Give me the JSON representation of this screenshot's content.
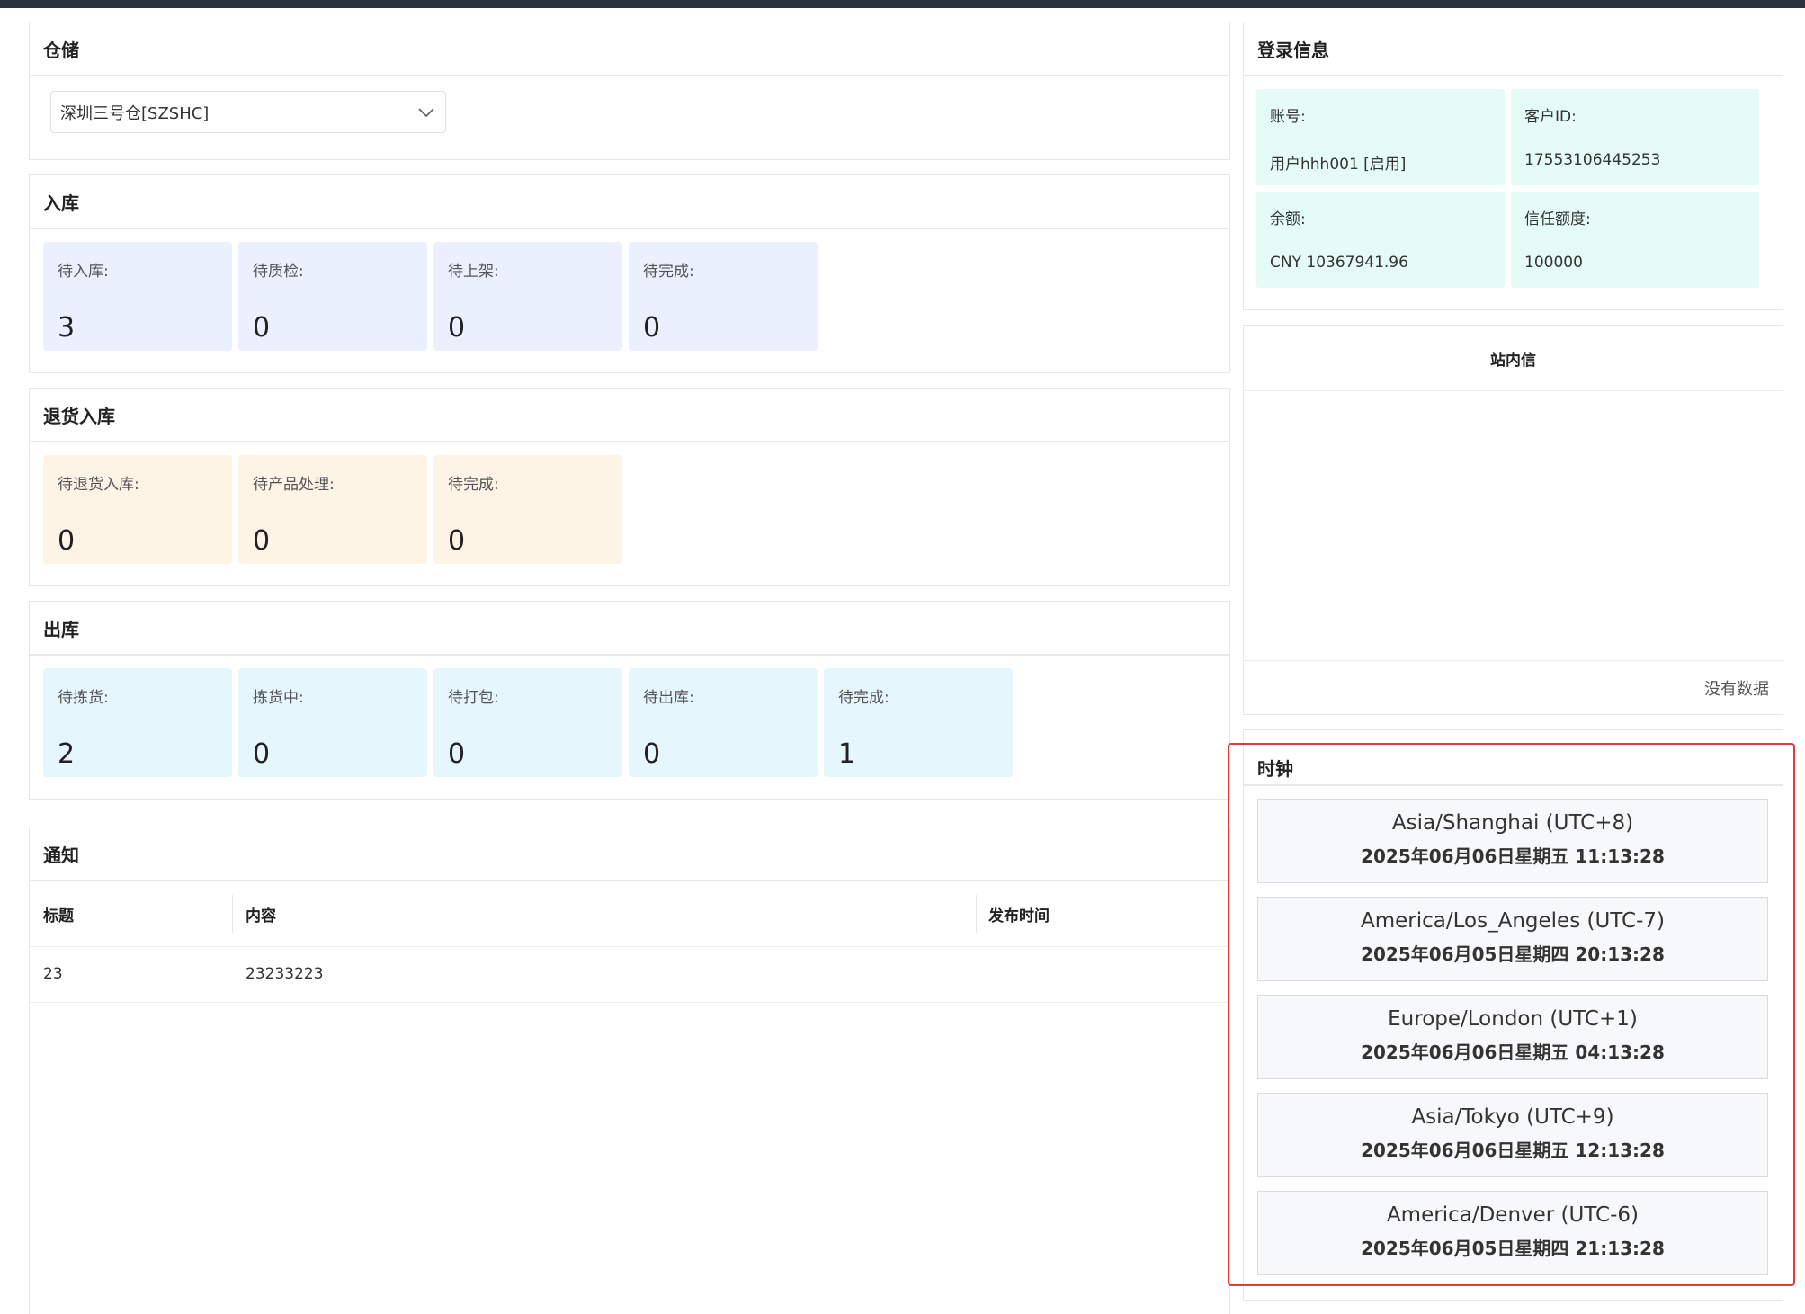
{
  "warehouse": {
    "title": "仓储",
    "selected": "深圳三号仓[SZSHC]"
  },
  "inbound": {
    "title": "入库",
    "cards": [
      {
        "label": "待入库:",
        "value": "3"
      },
      {
        "label": "待质检:",
        "value": "0"
      },
      {
        "label": "待上架:",
        "value": "0"
      },
      {
        "label": "待完成:",
        "value": "0"
      }
    ]
  },
  "returns": {
    "title": "退货入库",
    "cards": [
      {
        "label": "待退货入库:",
        "value": "0"
      },
      {
        "label": "待产品处理:",
        "value": "0"
      },
      {
        "label": "待完成:",
        "value": "0"
      }
    ]
  },
  "outbound": {
    "title": "出库",
    "cards": [
      {
        "label": "待拣货:",
        "value": "2"
      },
      {
        "label": "拣货中:",
        "value": "0"
      },
      {
        "label": "待打包:",
        "value": "0"
      },
      {
        "label": "待出库:",
        "value": "0"
      },
      {
        "label": "待完成:",
        "value": "1"
      }
    ]
  },
  "notice": {
    "title": "通知",
    "columns": [
      "标题",
      "内容",
      "发布时间"
    ],
    "rows": [
      {
        "title": "23",
        "content": "23233223",
        "time": ""
      }
    ]
  },
  "login": {
    "title": "登录信息",
    "account_label": "账号:",
    "account_value": "用户hhh001 [启用]",
    "customer_id_label": "客户ID:",
    "customer_id_value": "17553106445253",
    "balance_label": "余额:",
    "balance_value": "CNY 10367941.96",
    "credit_label": "信任额度:",
    "credit_value": "100000"
  },
  "messages": {
    "title": "站内信",
    "empty_text": "没有数据"
  },
  "clock": {
    "title": "时钟",
    "items": [
      {
        "zone": "Asia/Shanghai (UTC+8)",
        "time": "2025年06月06日星期五 11:13:28"
      },
      {
        "zone": "America/Los_Angeles (UTC-7)",
        "time": "2025年06月05日星期四 20:13:28"
      },
      {
        "zone": "Europe/London (UTC+1)",
        "time": "2025年06月06日星期五 04:13:28"
      },
      {
        "zone": "Asia/Tokyo (UTC+9)",
        "time": "2025年06月06日星期五 12:13:28"
      },
      {
        "zone": "America/Denver (UTC-6)",
        "time": "2025年06月05日星期四 21:13:28"
      }
    ]
  },
  "colors": {
    "highlight": "#e03a3a",
    "inbound_card": "#eaf0fe",
    "returns_card": "#fef4e6",
    "outbound_card": "#e5f6fd",
    "login_card": "#e4fbf6"
  }
}
